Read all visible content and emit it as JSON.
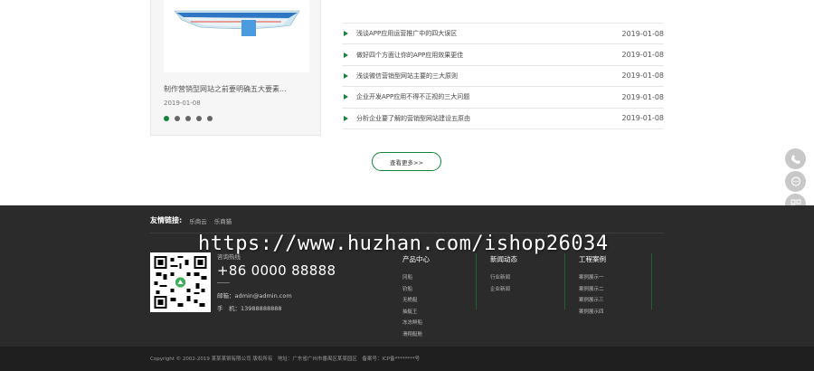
{
  "featured": {
    "title": "制作营销型网站之前要明确五大要素...",
    "date": "2019-01-08",
    "dots": 5,
    "active_dot": 0
  },
  "news": [
    {
      "title": "浅谈APP应用运营推广中的四大误区",
      "date": "2019-01-08"
    },
    {
      "title": "做好四个方面让你的APP应用效果更佳",
      "date": "2019-01-08"
    },
    {
      "title": "浅谈微信营销型网站主要的三大原则",
      "date": "2019-01-08"
    },
    {
      "title": "企业开发APP应用不得不正视的三大问题",
      "date": "2019-01-08"
    },
    {
      "title": "分析企业要了解的营销型网站建设五原由",
      "date": "2019-01-08"
    }
  ],
  "more_label": "查看更多>>",
  "float_icons": [
    "phone-icon",
    "message-icon",
    "qrcode-icon",
    "back-to-top-icon"
  ],
  "footer": {
    "links_label": "友情链接:",
    "links": [
      "乐商云",
      "乐商猫"
    ],
    "watermark": "https://www.huzhan.com/ishop26034",
    "contact_title": "咨询热线",
    "phone": "+86 0000 88888",
    "email": "邮箱：admin@admin.com",
    "mobile": "手　机：13988888888",
    "columns": [
      {
        "title": "产品中心",
        "items": [
          "冈船",
          "钓船",
          "无桅艇",
          "抽艇王",
          "冻冻鲜船",
          "滑翔艇舱"
        ]
      },
      {
        "title": "新闻动态",
        "items": [
          "行业新闻",
          "企业新闻"
        ]
      },
      {
        "title": "工程案例",
        "items": [
          "案例展示一",
          "案例展示二",
          "案例展示三",
          "案例展示四"
        ]
      }
    ],
    "copyright": "Copyright © 2002-2019 某某某钢有限公司 版权所有　地址：广东省广州市番禺区某某园区　备案号：ICP备********号"
  },
  "colors": {
    "accent": "#14843a",
    "footer_bg": "#2b2b2b",
    "bottom_bg": "#1f1f1f"
  }
}
